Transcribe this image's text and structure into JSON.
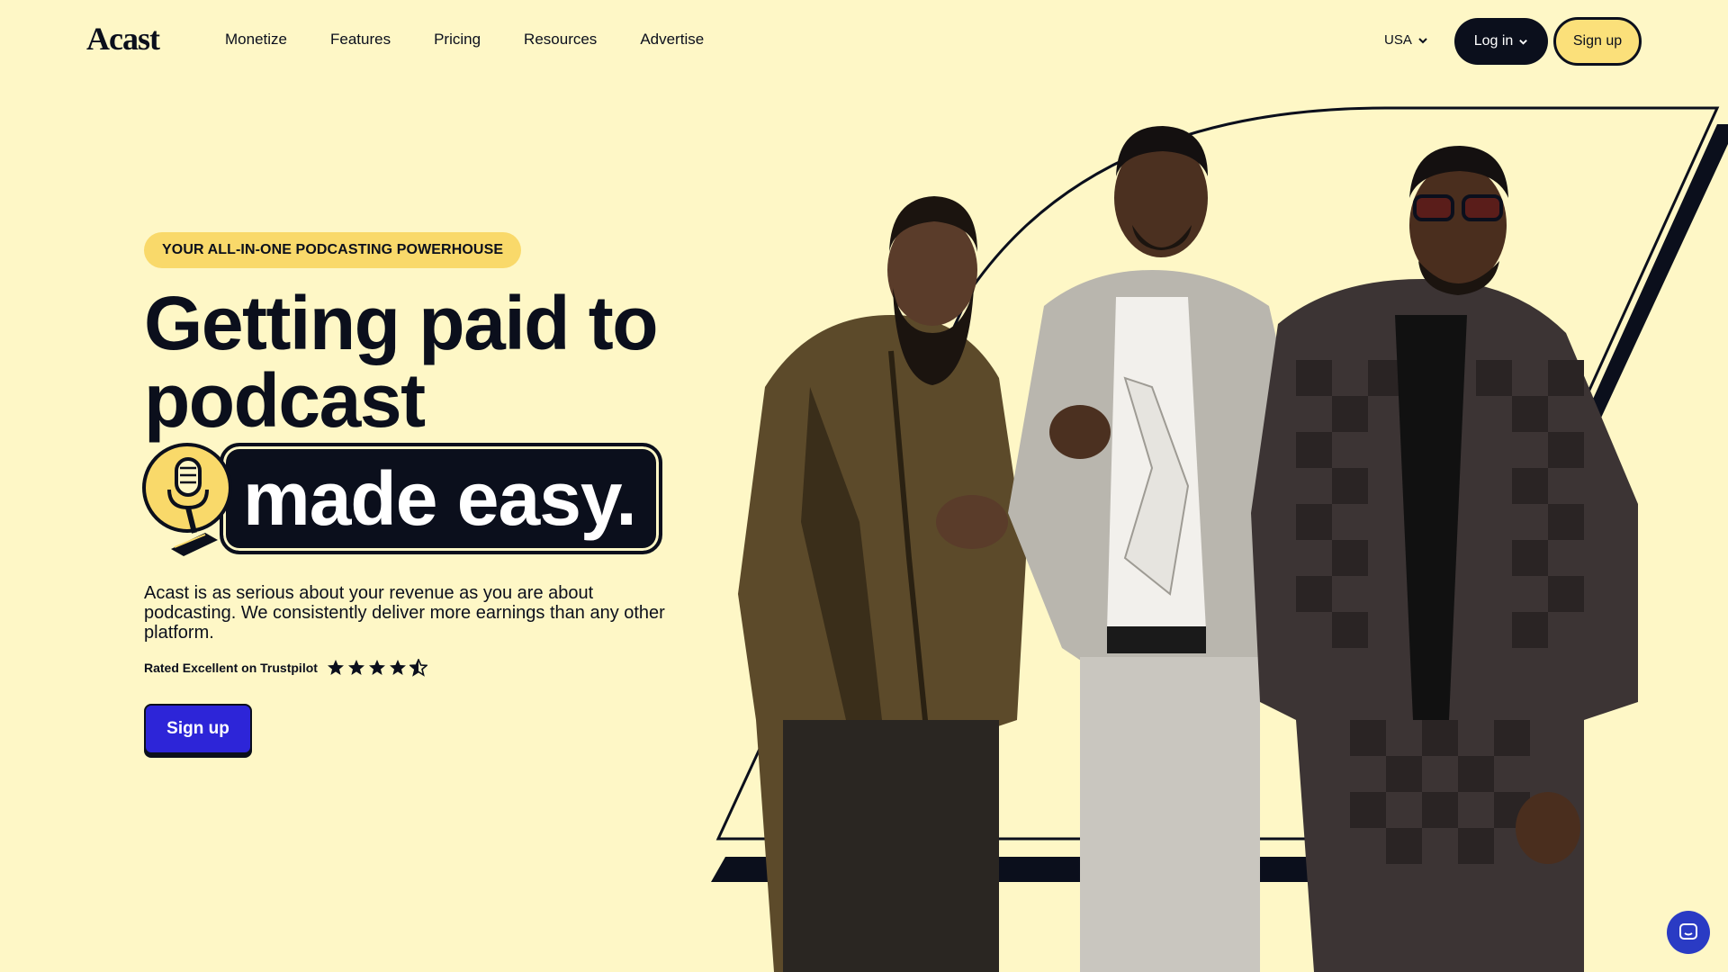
{
  "header": {
    "logo": "Acast",
    "nav": [
      "Monetize",
      "Features",
      "Pricing",
      "Resources",
      "Advertise"
    ],
    "region": "USA",
    "login_label": "Log in",
    "signup_label": "Sign up"
  },
  "hero": {
    "eyebrow": "YOUR ALL-IN-ONE PODCASTING POWERHOUSE",
    "headline": "Getting paid to podcast",
    "headline_highlight": "made easy.",
    "lede": "Acast is as serious about your revenue as you are about podcasting. We consistently deliver more earnings than any other platform.",
    "rating_text": "Rated Excellent on Trustpilot",
    "rating_value": 4.5,
    "rating_max": 5,
    "cta_label": "Sign up"
  },
  "colors": {
    "background": "#fef7c6",
    "ink": "#0b0f1c",
    "accent_yellow": "#f9d96a",
    "cta_blue": "#2d25d8"
  },
  "icons": {
    "microphone": "microphone-icon",
    "chat": "chat-icon",
    "star": "star-icon",
    "chevron": "chevron-down-icon"
  }
}
